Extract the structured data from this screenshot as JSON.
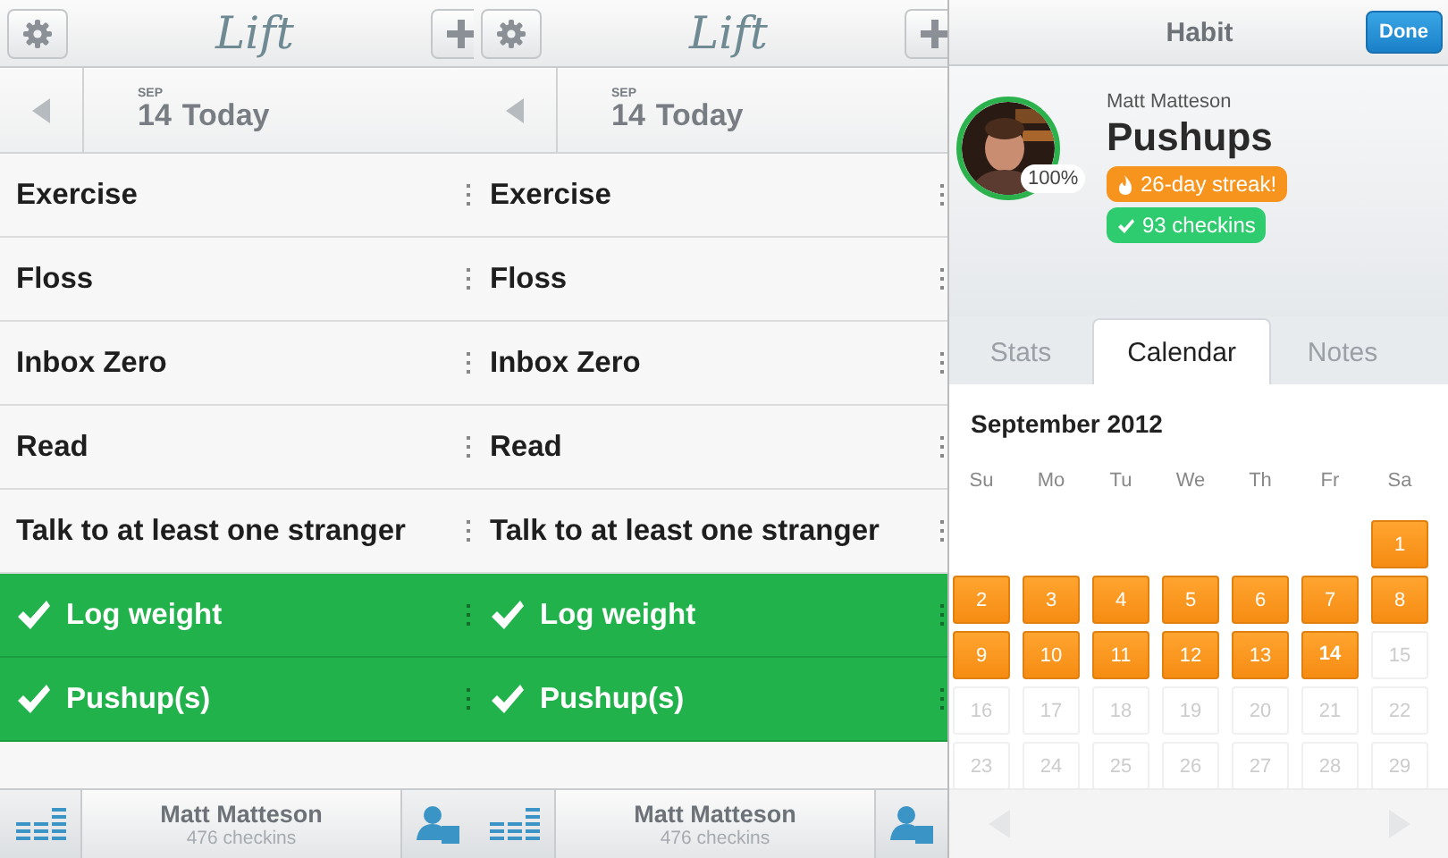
{
  "screens": [
    {
      "logo": "Lift",
      "date": {
        "month": "SEP",
        "day": "14",
        "label": "Today"
      },
      "habits": [
        {
          "name": "Exercise",
          "done": false
        },
        {
          "name": "Floss",
          "done": false
        },
        {
          "name": "Inbox Zero",
          "done": false
        },
        {
          "name": "Read",
          "done": false
        },
        {
          "name": "Talk to at least one stranger",
          "done": false
        },
        {
          "name": "Log weight",
          "done": true
        },
        {
          "name": "Pushup(s)",
          "done": true
        }
      ],
      "footer": {
        "name": "Matt Matteson",
        "checkins": "476 checkins"
      }
    },
    {
      "logo": "Lift",
      "date": {
        "month": "SEP",
        "day": "14",
        "label": "Today"
      },
      "habits": [
        {
          "name": "Exercise",
          "done": false
        },
        {
          "name": "Floss",
          "done": false
        },
        {
          "name": "Inbox Zero",
          "done": false
        },
        {
          "name": "Read",
          "done": false
        },
        {
          "name": "Talk to at least one stranger",
          "done": false
        },
        {
          "name": "Log weight",
          "done": true
        },
        {
          "name": "Pushup(s)",
          "done": true
        }
      ],
      "footer": {
        "name": "Matt Matteson",
        "checkins": "476 checkins"
      }
    }
  ],
  "detail": {
    "title": "Habit",
    "done_button": "Done",
    "user": "Matt Matteson",
    "habit": "Pushups",
    "percent": "100%",
    "streak": "26-day streak!",
    "checkins": "93 checkins",
    "tabs": [
      {
        "label": "Stats",
        "selected": false
      },
      {
        "label": "Calendar",
        "selected": true
      },
      {
        "label": "Notes",
        "selected": false
      }
    ],
    "calendar": {
      "month": "September 2012",
      "weekdays": [
        "Su",
        "Mo",
        "Tu",
        "We",
        "Th",
        "Fr",
        "Sa"
      ],
      "weeks": [
        [
          {
            "day": "1",
            "checked": true,
            "today": false
          }
        ],
        [
          {
            "day": "2",
            "checked": true,
            "today": false
          },
          {
            "day": "3",
            "checked": true,
            "today": false
          },
          {
            "day": "4",
            "checked": true,
            "today": false
          },
          {
            "day": "5",
            "checked": true,
            "today": false
          },
          {
            "day": "6",
            "checked": true,
            "today": false
          },
          {
            "day": "7",
            "checked": true,
            "today": false
          },
          {
            "day": "8",
            "checked": true,
            "today": false
          }
        ],
        [
          {
            "day": "9",
            "checked": true,
            "today": false
          },
          {
            "day": "10",
            "checked": true,
            "today": false
          },
          {
            "day": "11",
            "checked": true,
            "today": false
          },
          {
            "day": "12",
            "checked": true,
            "today": false
          },
          {
            "day": "13",
            "checked": true,
            "today": false
          },
          {
            "day": "14",
            "checked": true,
            "today": true
          },
          {
            "day": "15",
            "checked": false,
            "today": false
          }
        ],
        [
          {
            "day": "16",
            "checked": false,
            "today": false
          },
          {
            "day": "17",
            "checked": false,
            "today": false
          },
          {
            "day": "18",
            "checked": false,
            "today": false
          },
          {
            "day": "19",
            "checked": false,
            "today": false
          },
          {
            "day": "20",
            "checked": false,
            "today": false
          },
          {
            "day": "21",
            "checked": false,
            "today": false
          },
          {
            "day": "22",
            "checked": false,
            "today": false
          }
        ],
        [
          {
            "day": "23",
            "checked": false,
            "today": false
          },
          {
            "day": "24",
            "checked": false,
            "today": false
          },
          {
            "day": "25",
            "checked": false,
            "today": false
          },
          {
            "day": "26",
            "checked": false,
            "today": false
          },
          {
            "day": "27",
            "checked": false,
            "today": false
          },
          {
            "day": "28",
            "checked": false,
            "today": false
          },
          {
            "day": "29",
            "checked": false,
            "today": false
          }
        ]
      ]
    }
  }
}
